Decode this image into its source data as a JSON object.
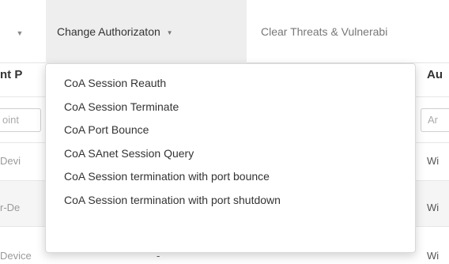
{
  "toolbar": {
    "change_authorization_label": "Change Authorizaton",
    "clear_threats_label": "Clear Threats & Vulnerabi"
  },
  "table": {
    "columns": [
      {
        "label": "nt P",
        "filter_placeholder": "oint"
      },
      {
        "label": "Au",
        "filter_placeholder": "Ar"
      }
    ],
    "rows": [
      {
        "c1": "Devi",
        "c2": "Wi"
      },
      {
        "c1": "r-De",
        "c2": "Wi"
      },
      {
        "c1": "Device",
        "c1_extra": "-",
        "c2": "Wi"
      }
    ]
  },
  "menu": {
    "items": [
      "CoA Session Reauth",
      "CoA Session Terminate",
      "CoA Port Bounce",
      "CoA SAnet Session Query",
      "CoA Session termination with port bounce",
      "CoA Session termination with port shutdown"
    ]
  }
}
